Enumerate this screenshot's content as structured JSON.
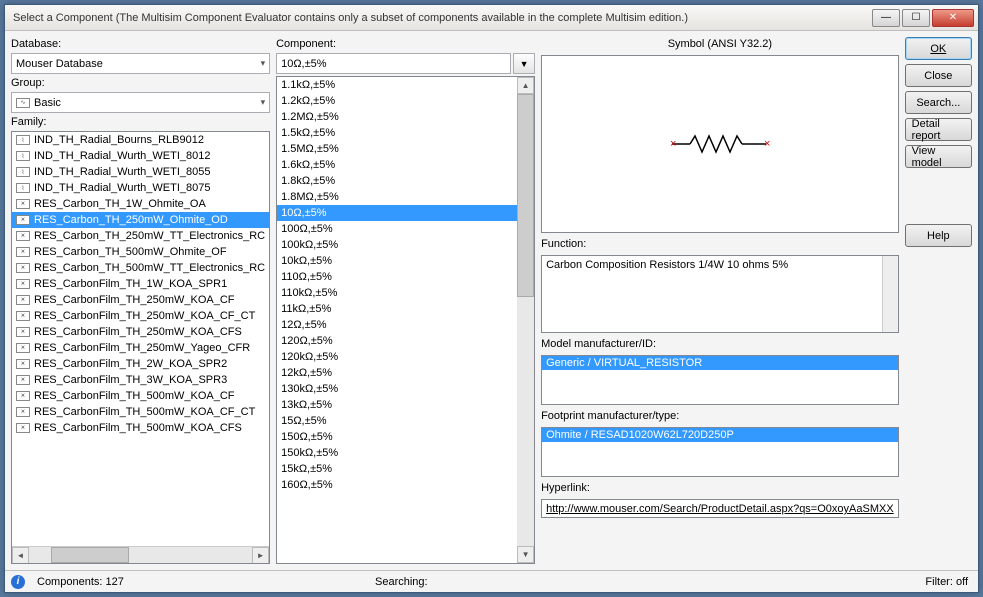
{
  "title": "Select a Component (The Multisim Component Evaluator contains only a subset of components available in the complete Multisim edition.)",
  "labels": {
    "database": "Database:",
    "group": "Group:",
    "family": "Family:",
    "component": "Component:",
    "symbol": "Symbol (ANSI Y32.2)",
    "function": "Function:",
    "model_mfr": "Model manufacturer/ID:",
    "footprint": "Footprint manufacturer/type:",
    "hyperlink": "Hyperlink:"
  },
  "database": "Mouser Database",
  "group": "Basic",
  "group_icon": "∿",
  "family_items": [
    {
      "icon": "⌇",
      "label": "IND_TH_Radial_Bourns_RLB9012"
    },
    {
      "icon": "⌇",
      "label": "IND_TH_Radial_Wurth_WETI_8012"
    },
    {
      "icon": "⌇",
      "label": "IND_TH_Radial_Wurth_WETI_8055"
    },
    {
      "icon": "⌇",
      "label": "IND_TH_Radial_Wurth_WETI_8075"
    },
    {
      "icon": "⩙",
      "label": "RES_Carbon_TH_1W_Ohmite_OA"
    },
    {
      "icon": "⩙",
      "label": "RES_Carbon_TH_250mW_Ohmite_OD",
      "sel": true
    },
    {
      "icon": "⩙",
      "label": "RES_Carbon_TH_250mW_TT_Electronics_RC"
    },
    {
      "icon": "⩙",
      "label": "RES_Carbon_TH_500mW_Ohmite_OF"
    },
    {
      "icon": "⩙",
      "label": "RES_Carbon_TH_500mW_TT_Electronics_RC"
    },
    {
      "icon": "⩙",
      "label": "RES_CarbonFilm_TH_1W_KOA_SPR1"
    },
    {
      "icon": "⩙",
      "label": "RES_CarbonFilm_TH_250mW_KOA_CF"
    },
    {
      "icon": "⩙",
      "label": "RES_CarbonFilm_TH_250mW_KOA_CF_CT"
    },
    {
      "icon": "⩙",
      "label": "RES_CarbonFilm_TH_250mW_KOA_CFS"
    },
    {
      "icon": "⩙",
      "label": "RES_CarbonFilm_TH_250mW_Yageo_CFR"
    },
    {
      "icon": "⩙",
      "label": "RES_CarbonFilm_TH_2W_KOA_SPR2"
    },
    {
      "icon": "⩙",
      "label": "RES_CarbonFilm_TH_3W_KOA_SPR3"
    },
    {
      "icon": "⩙",
      "label": "RES_CarbonFilm_TH_500mW_KOA_CF"
    },
    {
      "icon": "⩙",
      "label": "RES_CarbonFilm_TH_500mW_KOA_CF_CT"
    },
    {
      "icon": "⩙",
      "label": "RES_CarbonFilm_TH_500mW_KOA_CFS"
    }
  ],
  "component_search": "10Ω,±5%",
  "component_items": [
    "1.1kΩ,±5%",
    "1.2kΩ,±5%",
    "1.2MΩ,±5%",
    "1.5kΩ,±5%",
    "1.5MΩ,±5%",
    "1.6kΩ,±5%",
    "1.8kΩ,±5%",
    "1.8MΩ,±5%",
    {
      "label": "10Ω,±5%",
      "sel": true
    },
    "100Ω,±5%",
    "100kΩ,±5%",
    "10kΩ,±5%",
    "110Ω,±5%",
    "110kΩ,±5%",
    "11kΩ,±5%",
    "12Ω,±5%",
    "120Ω,±5%",
    "120kΩ,±5%",
    "12kΩ,±5%",
    "130kΩ,±5%",
    "13kΩ,±5%",
    "15Ω,±5%",
    "150Ω,±5%",
    "150kΩ,±5%",
    "15kΩ,±5%",
    "160Ω,±5%"
  ],
  "function_text": "Carbon Composition Resistors 1/4W 10 ohms 5%",
  "model_mfr": "Generic / VIRTUAL_RESISTOR",
  "footprint": "Ohmite / RESAD1020W62L720D250P",
  "hyperlink": "http://www.mouser.com/Search/ProductDetail.aspx?qs=O0xoyAaSMXX",
  "buttons": {
    "ok": "OK",
    "close": "Close",
    "search": "Search...",
    "detail": "Detail report",
    "view": "View model",
    "help": "Help"
  },
  "status": {
    "components": "Components: 127",
    "searching": "Searching:",
    "filter": "Filter: off"
  }
}
